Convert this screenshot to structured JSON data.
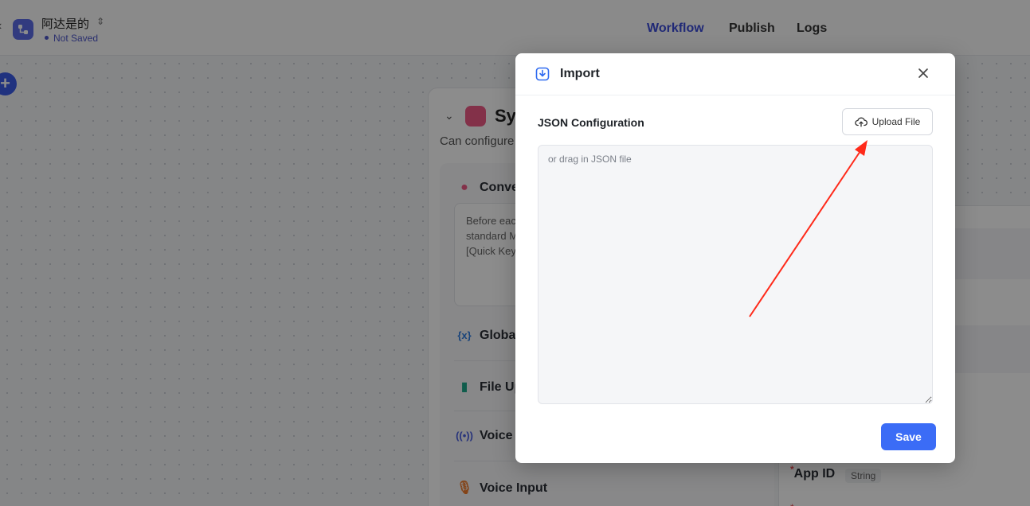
{
  "header": {
    "app_name": "阿达是的",
    "save_status": "Not Saved",
    "tabs": [
      {
        "label": "Workflow",
        "active": true
      },
      {
        "label": "Publish",
        "active": false
      },
      {
        "label": "Logs",
        "active": false
      }
    ]
  },
  "system_panel": {
    "title_visible": "Sys",
    "description_visible": "Can configure",
    "sections": [
      {
        "label": "Conve",
        "icon": "chat-bubble-icon"
      },
      {
        "label": "Global",
        "icon": "variable-icon"
      },
      {
        "label": "File Up",
        "icon": "file-icon"
      },
      {
        "label": "Voice",
        "icon": "broadcast-icon"
      },
      {
        "label": "Voice Input",
        "icon": "microphone-icon"
      }
    ],
    "conversation_text_lines": [
      "Before eac",
      "standard M",
      "[Quick Key"
    ]
  },
  "right_panel": {
    "field_label": "App ID",
    "field_type": "String"
  },
  "modal": {
    "title": "Import",
    "json_label": "JSON Configuration",
    "upload_label": "Upload File",
    "textarea_placeholder": "or drag in JSON file",
    "save_label": "Save"
  },
  "colors": {
    "accent": "#3b6cf6",
    "annotation_arrow": "#ff2a1a",
    "active_tab": "#3b4bd8"
  }
}
